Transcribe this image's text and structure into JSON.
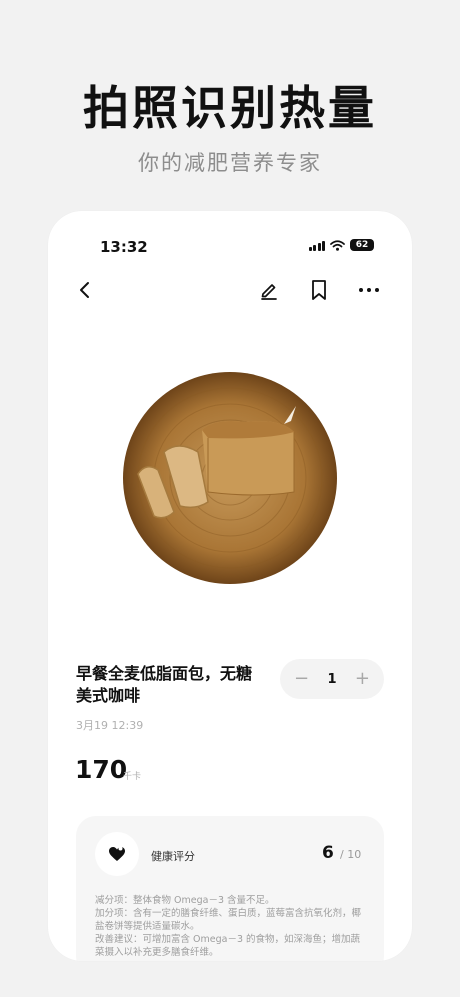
{
  "promo": {
    "title": "拍照识别热量",
    "subtitle": "你的减肥营养专家"
  },
  "status_bar": {
    "time": "13:32",
    "battery": "62"
  },
  "nav": {
    "icons": [
      "back-arrow-icon",
      "edit-pencil-icon",
      "bookmark-icon",
      "more-icon"
    ]
  },
  "food": {
    "name": "早餐全麦低脂面包，无糖美式咖啡",
    "time": "3月19 12:39",
    "quantity": "1",
    "minus": "−",
    "plus": "+"
  },
  "calories": {
    "value": "170",
    "unit": "千卡"
  },
  "health": {
    "label": "健康评分",
    "score": "6",
    "max": "/ 10",
    "lines": [
      "减分项：整体食物 Omega－3 含量不足。",
      "加分项：含有一定的膳食纤维、蛋白质，蓝莓富含抗氧化剂，椰盐卷饼等提供适量碳水。",
      "改善建议：可增加富含 Omega－3 的食物，如深海鱼；增加蔬菜摄入以补充更多膳食纤维。"
    ]
  },
  "colors": {
    "background": "#f2f2f2",
    "card": "#ffffff",
    "accent_text": "#111111",
    "muted_text": "#9e9e9e"
  }
}
